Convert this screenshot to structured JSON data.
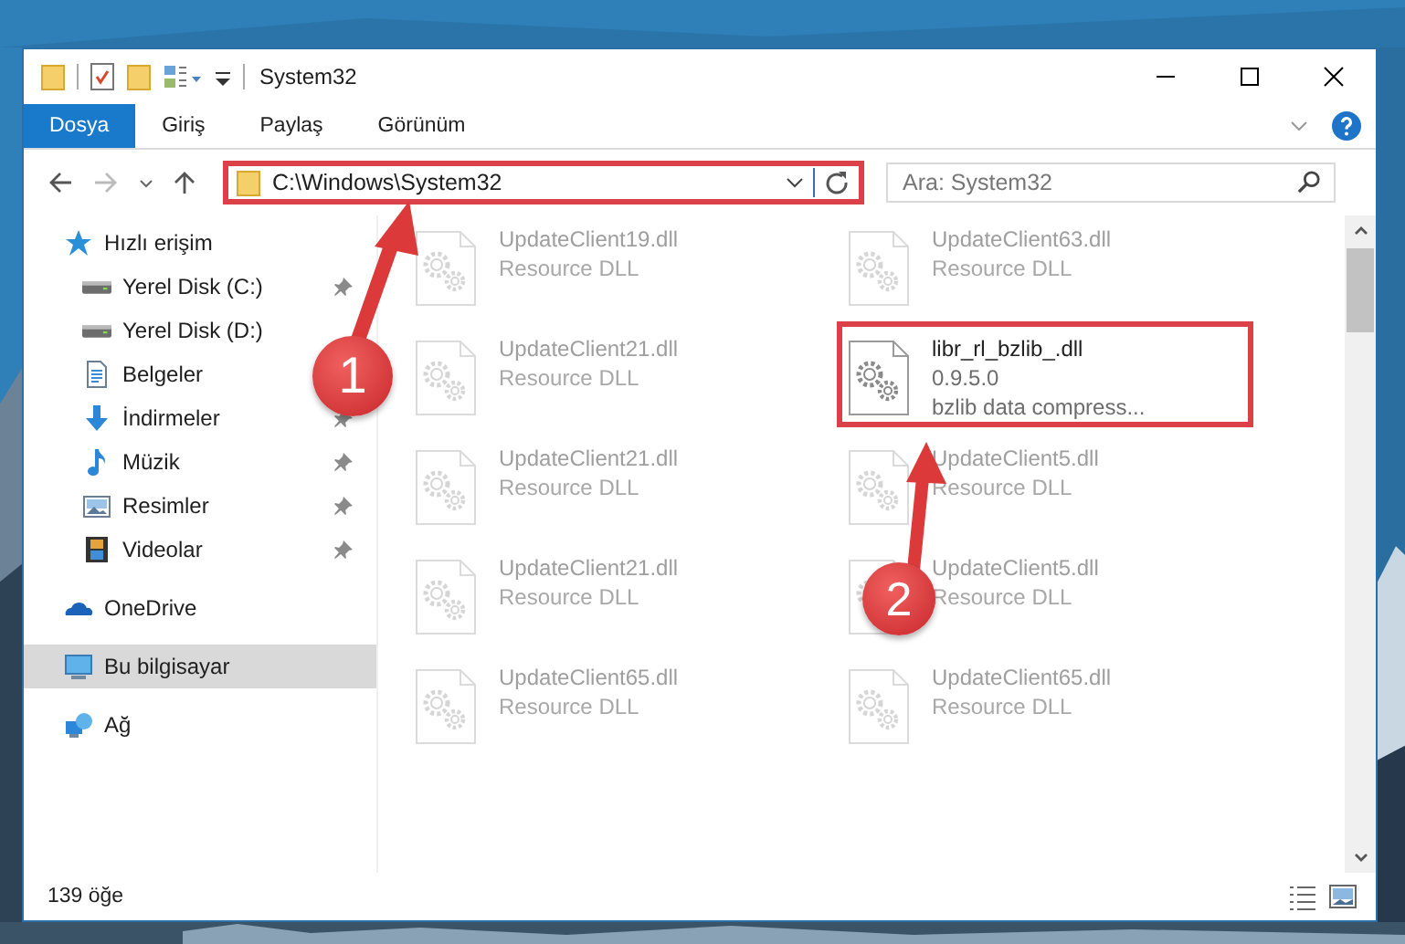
{
  "window": {
    "title": "System32"
  },
  "ribbon": {
    "tabs": [
      {
        "label": "Dosya",
        "selected": true
      },
      {
        "label": "Giriş",
        "selected": false
      },
      {
        "label": "Paylaş",
        "selected": false
      },
      {
        "label": "Görünüm",
        "selected": false
      }
    ]
  },
  "address_bar": {
    "path": "C:\\Windows\\System32",
    "highlighted": true
  },
  "search": {
    "placeholder": "Ara: System32"
  },
  "sidebar": {
    "items": [
      {
        "label": "Hızlı erişim",
        "kind": "star",
        "selected": false,
        "children": [
          {
            "label": "Yerel Disk (C:)",
            "kind": "disk",
            "pinned": true,
            "selected": false
          },
          {
            "label": "Yerel Disk (D:)",
            "kind": "disk",
            "pinned": false,
            "selected": false
          },
          {
            "label": "Belgeler",
            "kind": "documents",
            "pinned": false,
            "selected": false
          },
          {
            "label": "İndirmeler",
            "kind": "downloads",
            "pinned": true,
            "selected": false
          },
          {
            "label": "Müzik",
            "kind": "music",
            "pinned": true,
            "selected": false
          },
          {
            "label": "Resimler",
            "kind": "pictures",
            "pinned": true,
            "selected": false
          },
          {
            "label": "Videolar",
            "kind": "videos",
            "pinned": true,
            "selected": false
          }
        ]
      },
      {
        "label": "OneDrive",
        "kind": "cloud",
        "selected": false
      },
      {
        "label": "Bu bilgisayar",
        "kind": "computer",
        "selected": true
      },
      {
        "label": "Ağ",
        "kind": "network",
        "selected": false
      }
    ]
  },
  "files": [
    {
      "name": "UpdateClient19.dll",
      "details": [
        "Resource DLL"
      ],
      "faded": true,
      "highlighted": false
    },
    {
      "name": "UpdateClient63.dll",
      "details": [
        "Resource DLL"
      ],
      "faded": true,
      "highlighted": false
    },
    {
      "name": "UpdateClient21.dll",
      "details": [
        "Resource DLL"
      ],
      "faded": true,
      "highlighted": false
    },
    {
      "name": "libr_rl_bzlib_.dll",
      "details": [
        "0.9.5.0",
        "bzlib data compress..."
      ],
      "faded": false,
      "highlighted": true
    },
    {
      "name": "UpdateClient21.dll",
      "details": [
        "Resource DLL"
      ],
      "faded": true,
      "highlighted": false
    },
    {
      "name": "UpdateClient5.dll",
      "details": [
        "Resource DLL"
      ],
      "faded": true,
      "highlighted": false
    },
    {
      "name": "UpdateClient21.dll",
      "details": [
        "Resource DLL"
      ],
      "faded": true,
      "highlighted": false
    },
    {
      "name": "UpdateClient5.dll",
      "details": [
        "Resource DLL"
      ],
      "faded": true,
      "highlighted": false
    },
    {
      "name": "UpdateClient65.dll",
      "details": [
        "Resource DLL"
      ],
      "faded": true,
      "highlighted": false
    },
    {
      "name": "UpdateClient65.dll",
      "details": [
        "Resource DLL"
      ],
      "faded": true,
      "highlighted": false
    }
  ],
  "annotations": [
    {
      "label": "1"
    },
    {
      "label": "2"
    }
  ],
  "status_bar": {
    "item_count": "139 öğe"
  }
}
